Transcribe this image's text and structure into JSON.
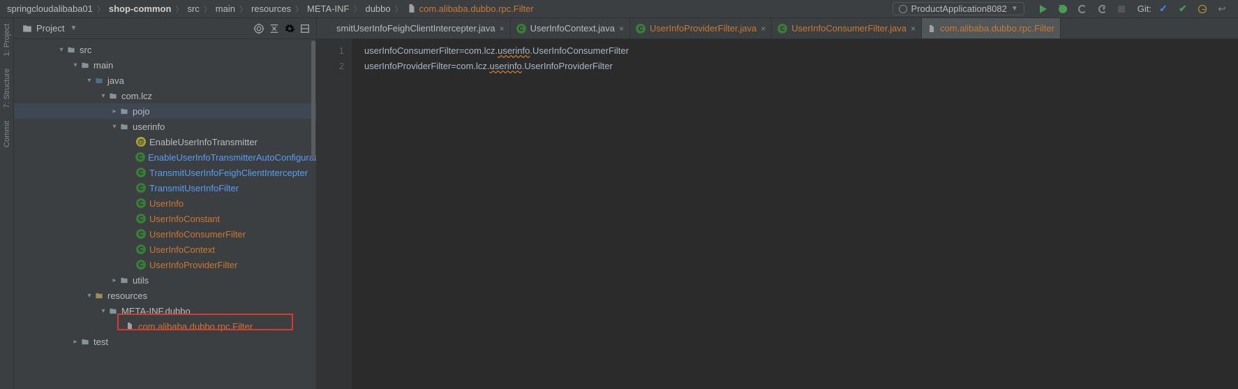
{
  "breadcrumbs": {
    "items": [
      "springcloudalibaba01",
      "shop-common",
      "src",
      "main",
      "resources",
      "META-INF",
      "dubbo"
    ],
    "file": "com.alibaba.dubbo.rpc.Filter"
  },
  "run": {
    "config": "ProductApplication8082"
  },
  "toolbar": {
    "git_label": "Git:"
  },
  "rail": {
    "project": "1: Project",
    "structure": "7: Structure",
    "commit": "Commit"
  },
  "panel": {
    "title": "Project"
  },
  "tree": {
    "n0": {
      "label": "src"
    },
    "n1": {
      "label": "main"
    },
    "n2": {
      "label": "java"
    },
    "n3": {
      "label": "com.lcz"
    },
    "n4": {
      "label": "pojo"
    },
    "n5": {
      "label": "userinfo"
    },
    "n6": {
      "label": "EnableUserInfoTransmitter"
    },
    "n7": {
      "label": "EnableUserInfoTransmitterAutoConfiguration"
    },
    "n8": {
      "label": "TransmitUserInfoFeighClientIntercepter"
    },
    "n9": {
      "label": "TransmitUserInfoFilter"
    },
    "n10": {
      "label": "UserInfo"
    },
    "n11": {
      "label": "UserInfoConstant"
    },
    "n12": {
      "label": "UserInfoConsumerFilter"
    },
    "n13": {
      "label": "UserInfoContext"
    },
    "n14": {
      "label": "UserInfoProviderFilter"
    },
    "n15": {
      "label": "utils"
    },
    "n16": {
      "label": "resources"
    },
    "n17": {
      "label": "META-INF.dubbo"
    },
    "n18": {
      "label": "com.alibaba.dubbo.rpc.Filter"
    },
    "n19": {
      "label": "test"
    }
  },
  "tabs": {
    "t0": {
      "label": "smitUserInfoFeighClientIntercepter.java"
    },
    "t1": {
      "label": "UserInfoContext.java"
    },
    "t2": {
      "label": "UserInfoProviderFilter.java"
    },
    "t3": {
      "label": "UserInfoConsumerFilter.java"
    },
    "t4": {
      "label": "com.alibaba.dubbo.rpc.Filter"
    }
  },
  "editor": {
    "lines": [
      "1",
      "2"
    ],
    "l1a": "userInfoConsumerFilter=com.lcz.",
    "l1b": "userinfo",
    "l1c": ".UserInfoConsumerFilter",
    "l2a": "userInfoProviderFilter=com.lcz.",
    "l2b": "userinfo",
    "l2c": ".UserInfoProviderFilter"
  }
}
